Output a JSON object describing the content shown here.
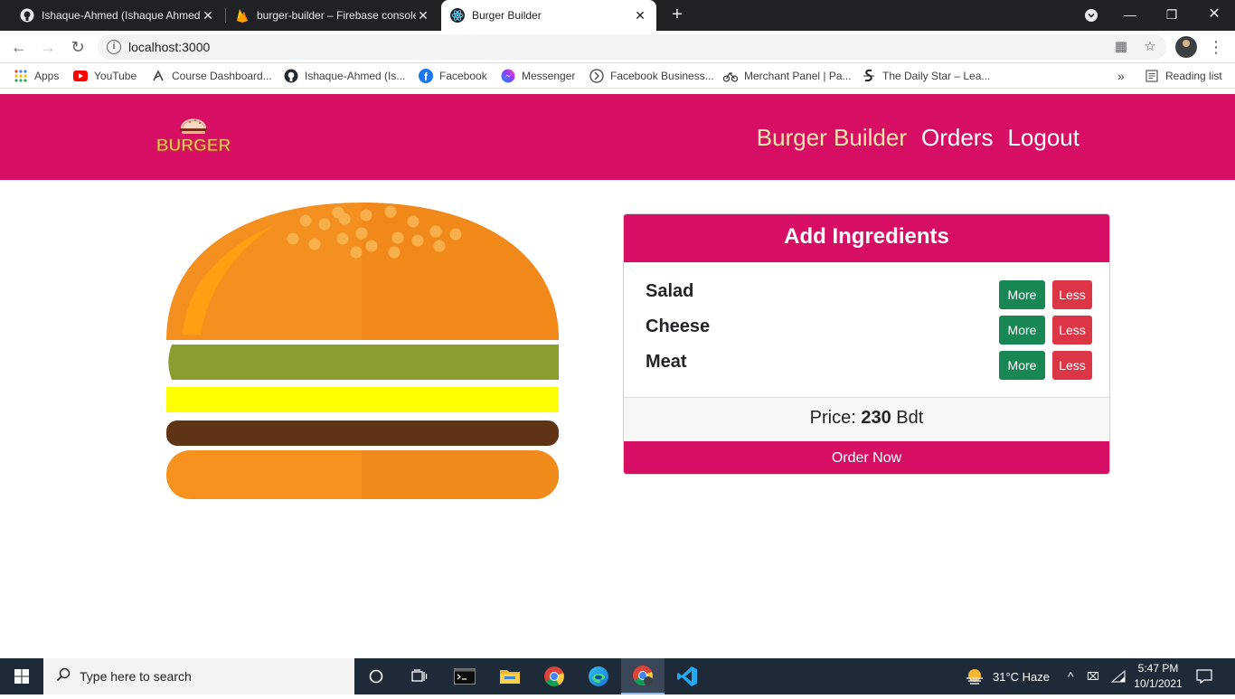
{
  "browser": {
    "tabs": [
      {
        "title": "Ishaque-Ahmed (Ishaque Ahmed)",
        "icon": "github-icon",
        "active": false
      },
      {
        "title": "burger-builder – Firebase console",
        "icon": "firebase-icon",
        "active": false
      },
      {
        "title": "Burger Builder",
        "icon": "react-icon",
        "active": true
      }
    ],
    "url": "localhost:3000",
    "bookmarks": [
      {
        "label": "Apps",
        "icon": "apps-grid-icon"
      },
      {
        "label": "YouTube",
        "icon": "youtube-icon"
      },
      {
        "label": "Course Dashboard...",
        "icon": "course-icon"
      },
      {
        "label": "Ishaque-Ahmed (Is...",
        "icon": "github-icon"
      },
      {
        "label": "Facebook",
        "icon": "facebook-icon"
      },
      {
        "label": "Messenger",
        "icon": "messenger-icon"
      },
      {
        "label": "Facebook Business...",
        "icon": "facebook-business-icon"
      },
      {
        "label": "Merchant Panel | Pa...",
        "icon": "bike-icon"
      },
      {
        "label": "The Daily Star – Lea...",
        "icon": "daily-star-icon"
      }
    ],
    "more_bookmarks": "»",
    "reading_list": "Reading list"
  },
  "app": {
    "logo_text": "BURGER",
    "nav": {
      "builder": "Burger Builder",
      "orders": "Orders",
      "logout": "Logout"
    },
    "panel": {
      "title": "Add Ingredients",
      "ingredients": [
        {
          "label": "Salad",
          "more": "More",
          "less": "Less"
        },
        {
          "label": "Cheese",
          "more": "More",
          "less": "Less"
        },
        {
          "label": "Meat",
          "more": "More",
          "less": "Less"
        }
      ],
      "price_label": "Price:",
      "price_value": "230",
      "currency": "Bdt",
      "order_button": "Order Now"
    },
    "colors": {
      "brand": "#d70f64",
      "salad": "#8a9e2e",
      "cheese": "#ffff00",
      "meat": "#5e3414",
      "bun": "#f39020"
    }
  },
  "taskbar": {
    "search_placeholder": "Type here to search",
    "weather": "31°C  Haze",
    "time": "5:47 PM",
    "date": "10/1/2021"
  }
}
